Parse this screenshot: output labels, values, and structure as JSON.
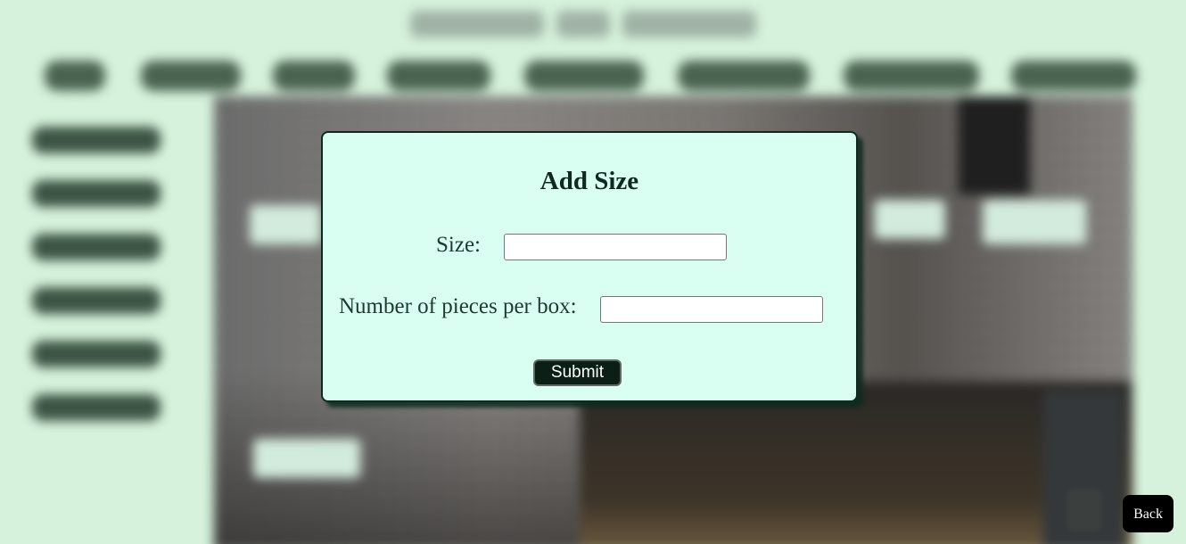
{
  "modal": {
    "title": "Add Size",
    "size_label": "Size:",
    "size_value": "",
    "pieces_label": "Number of pieces per box:",
    "pieces_value": "",
    "submit_label": "Submit"
  },
  "back_label": "Back",
  "background": {
    "blurred": true,
    "nav_button_count": 8,
    "sidebar_button_count": 6
  },
  "colors": {
    "page_background": "#d6f2dc",
    "modal_background": "#d9fef2",
    "modal_border": "#0e2a20",
    "submit_background": "#0c1f17",
    "back_background": "#000000"
  }
}
